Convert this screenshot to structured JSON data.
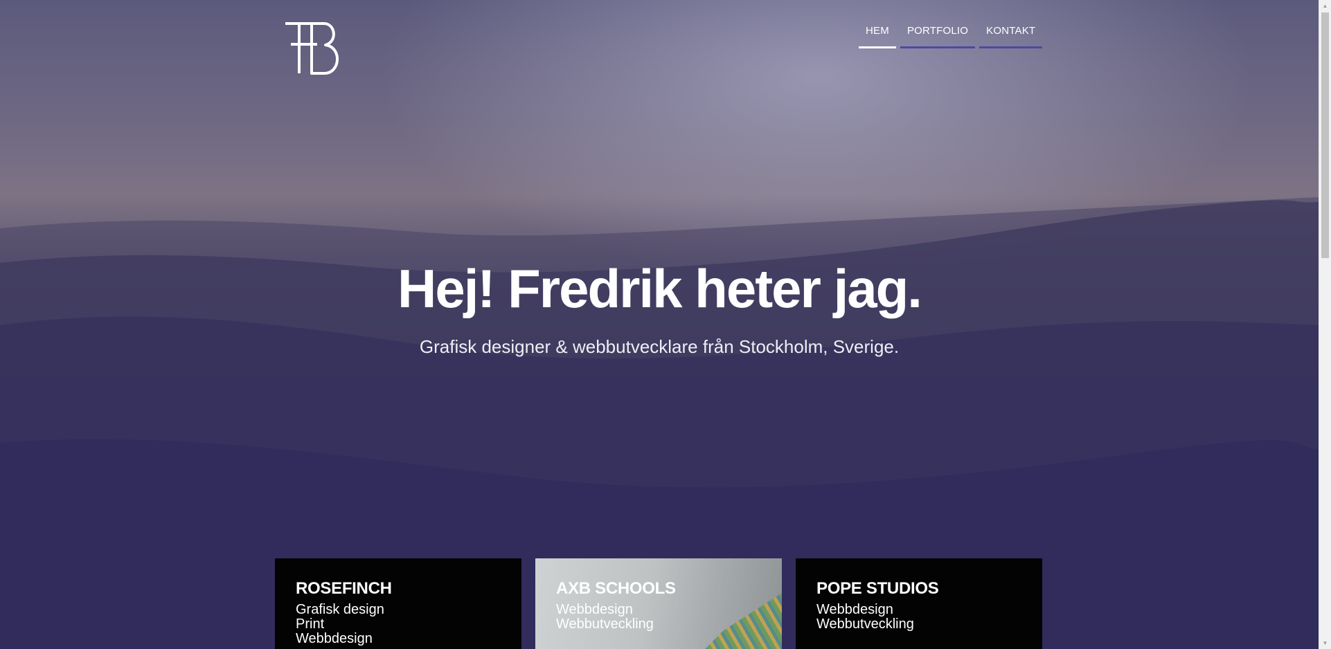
{
  "header": {
    "logo_icon": "fb-monogram-icon",
    "nav": [
      {
        "label": "HEM",
        "active": true
      },
      {
        "label": "PORTFOLIO",
        "active": false
      },
      {
        "label": "KONTAKT",
        "active": false
      }
    ]
  },
  "hero": {
    "title": "Hej! Fredrik heter jag.",
    "subtitle": "Grafisk designer & webbutvecklare från Stockholm, Sverige."
  },
  "cards": [
    {
      "title": "ROSEFINCH",
      "tags": [
        "Grafisk design",
        "Print",
        "Webbdesign"
      ]
    },
    {
      "title": "AXB SCHOOLS",
      "tags": [
        "Webbdesign",
        "Webbutveckling"
      ]
    },
    {
      "title": "POPE STUDIOS",
      "tags": [
        "Webbdesign",
        "Webbutveckling"
      ]
    }
  ],
  "colors": {
    "nav_underline": "#4d4aa0",
    "nav_active_underline": "#ffffff",
    "card_background": "#030303",
    "hero_overlay": "#2f2a5a"
  }
}
